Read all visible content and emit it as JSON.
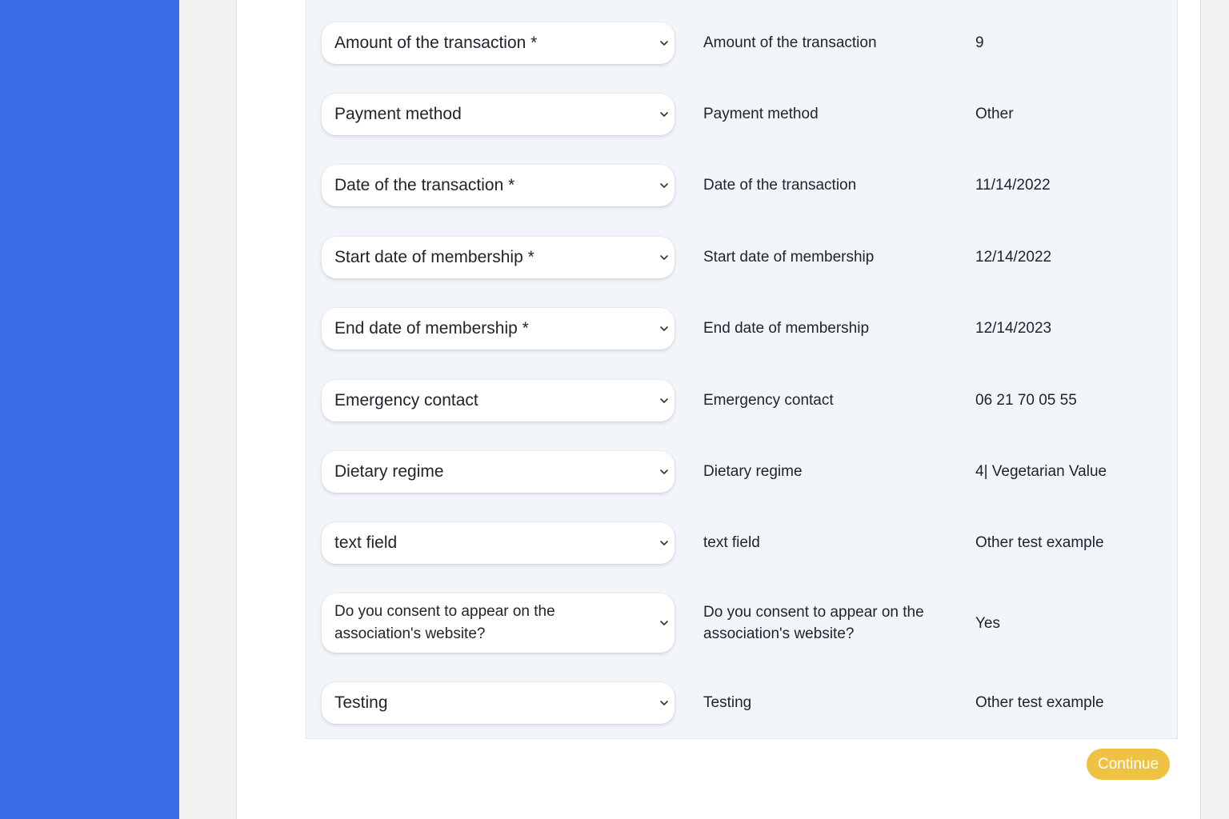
{
  "mapping_rows": [
    {
      "select_label": "Amount of the transaction *",
      "field_name": "Amount of the transaction",
      "value": "9"
    },
    {
      "select_label": "Payment method",
      "field_name": "Payment method",
      "value": "Other"
    },
    {
      "select_label": "Date of the transaction *",
      "field_name": "Date of the transaction",
      "value": "11/14/2022"
    },
    {
      "select_label": "Start date of membership *",
      "field_name": "Start date of membership",
      "value": "12/14/2022"
    },
    {
      "select_label": "End date of membership *",
      "field_name": "End date of membership",
      "value": "12/14/2023"
    },
    {
      "select_label": "Emergency contact",
      "field_name": "Emergency contact",
      "value": "06 21 70 05 55"
    },
    {
      "select_label": "Dietary regime",
      "field_name": "Dietary regime",
      "value": "4| Vegetarian Value"
    },
    {
      "select_label": "text field",
      "field_name": "text field",
      "value": "Other test example"
    },
    {
      "select_label": "Do you consent to appear on the association's website?",
      "field_name": "Do you consent to appear on the association's website?",
      "value": "Yes"
    },
    {
      "select_label": "Testing",
      "field_name": "Testing",
      "value": "Other test example"
    }
  ],
  "actions": {
    "continue_label": "Continue"
  },
  "colors": {
    "sidebar": "#3b6be6",
    "panel": "#f2f6fb",
    "continue_button": "#f0c243"
  },
  "icons": {
    "dropdown": "chevron-down-icon"
  }
}
